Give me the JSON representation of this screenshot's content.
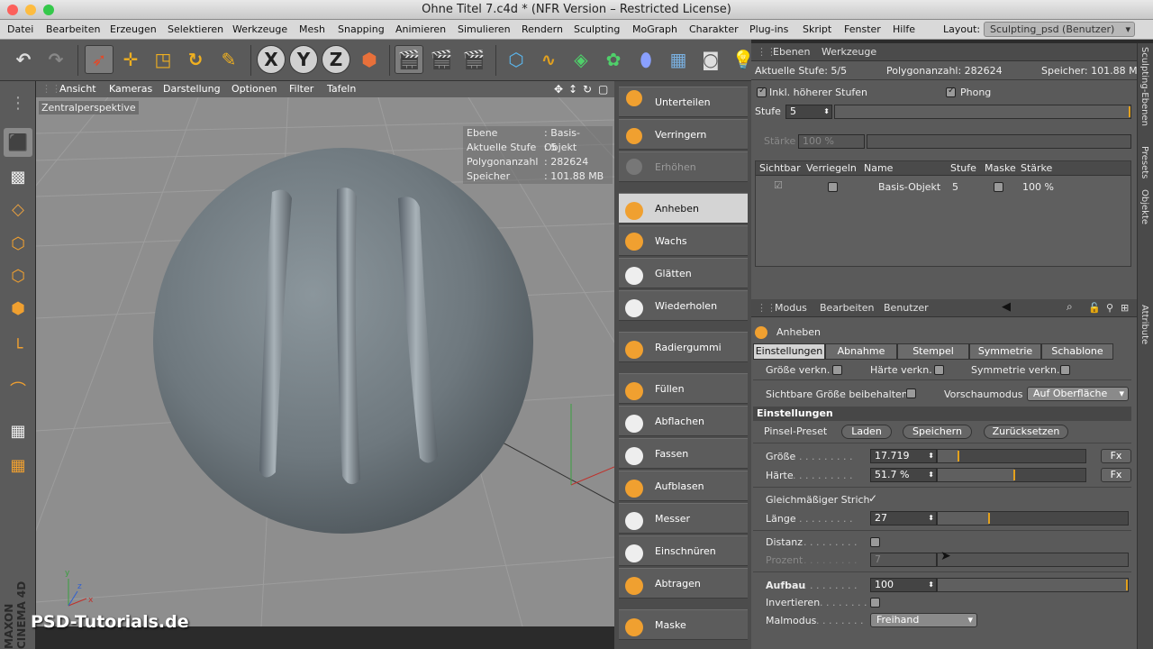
{
  "window": {
    "title": "Ohne Titel 7.c4d * (NFR Version – Restricted License)"
  },
  "menu": {
    "items": [
      "Datei",
      "Bearbeiten",
      "Erzeugen",
      "Selektieren",
      "Werkzeuge",
      "Mesh",
      "Snapping",
      "Animieren",
      "Simulieren",
      "Rendern",
      "Sculpting",
      "MoGraph",
      "Charakter",
      "Plug-ins",
      "Skript",
      "Fenster",
      "Hilfe"
    ],
    "layout_label": "Layout:",
    "layout_value": "Sculpting_psd (Benutzer)"
  },
  "viewport": {
    "menu": [
      "Ansicht",
      "Kameras",
      "Darstellung",
      "Optionen",
      "Filter",
      "Tafeln"
    ],
    "view_name": "Zentralperspektive",
    "hud": [
      {
        "k": "Ebene",
        "v": ": Basis-Objekt"
      },
      {
        "k": "Aktuelle Stufe",
        "v": ": 5"
      },
      {
        "k": "Polygonanzahl",
        "v": ": 282624"
      },
      {
        "k": "Speicher",
        "v": ": 101.88 MB"
      }
    ]
  },
  "brushes": [
    {
      "label": "Unterteilen",
      "state": "normal"
    },
    {
      "label": "Verringern",
      "state": "normal"
    },
    {
      "label": "Erhöhen",
      "state": "dim"
    },
    {
      "label": "Anheben",
      "state": "active"
    },
    {
      "label": "Wachs",
      "state": "normal"
    },
    {
      "label": "Glätten",
      "state": "normal"
    },
    {
      "label": "Wiederholen",
      "state": "normal"
    },
    {
      "label": "Radiergummi",
      "state": "normal"
    },
    {
      "label": "Füllen",
      "state": "normal"
    },
    {
      "label": "Abflachen",
      "state": "normal"
    },
    {
      "label": "Fassen",
      "state": "normal"
    },
    {
      "label": "Aufblasen",
      "state": "normal"
    },
    {
      "label": "Messer",
      "state": "normal"
    },
    {
      "label": "Einschnüren",
      "state": "normal"
    },
    {
      "label": "Abtragen",
      "state": "normal"
    },
    {
      "label": "Maske",
      "state": "normal"
    }
  ],
  "layers_panel": {
    "menu": [
      "Ebenen",
      "Werkzeuge"
    ],
    "current_level": "Aktuelle Stufe: 5/5",
    "poly_count": "Polygonanzahl: 282624",
    "memory": "Speicher: 101.88 MB",
    "incl_higher": "Inkl. höherer Stufen",
    "phong": "Phong",
    "level_label": "Stufe",
    "level_value": "5",
    "strength_label": "Stärke",
    "strength_value": "100 %",
    "columns": [
      "Sichtbar",
      "Verriegeln",
      "Name",
      "Stufe",
      "Maske",
      "Stärke"
    ],
    "rows": [
      {
        "name": "Basis-Objekt",
        "level": "5",
        "strength": "100 %"
      }
    ]
  },
  "attributes": {
    "menu": [
      "Modus",
      "Bearbeiten",
      "Benutzer"
    ],
    "tool_name": "Anheben",
    "tabs": [
      "Einstellungen",
      "Abnahme",
      "Stempel",
      "Symmetrie",
      "Schablone"
    ],
    "size_link": "Größe verkn.",
    "hardness_link": "Härte verkn.",
    "symmetry_link": "Symmetrie verkn.",
    "keep_visible_size": "Sichtbare Größe beibehalten",
    "preview_mode_label": "Vorschaumodus",
    "preview_mode_value": "Auf Oberfläche",
    "section": "Einstellungen",
    "preset_label": "Pinsel-Preset",
    "load": "Laden",
    "save": "Speichern",
    "reset": "Zurücksetzen",
    "size_label": "Größe",
    "size_value": "17.719",
    "size_level": 0.14,
    "hardness_label": "Härte",
    "hardness_value": "51.7 %",
    "hardness_level": 0.517,
    "fx": "Fx",
    "steady_stroke": "Gleichmäßiger Strich",
    "length_label": "Länge",
    "length_value": "27",
    "length_level": 0.27,
    "distance_label": "Distanz",
    "percent_label": "Prozent",
    "percent_value": "7",
    "buildup_label": "Aufbau",
    "buildup_value": "100",
    "invert_label": "Invertieren",
    "paint_mode_label": "Malmodus",
    "paint_mode_value": "Freihand"
  },
  "right_tabs": [
    "Sculpting-Ebenen",
    "Presets",
    "Objekte",
    "Attribute"
  ],
  "watermark": "PSD-Tutorials.de",
  "brand_vertical": "MAXON CINEMA 4D",
  "colors": {
    "accent": "#e3a11d",
    "panel": "#5a5a5a",
    "viewport": "#8e8e8e"
  }
}
